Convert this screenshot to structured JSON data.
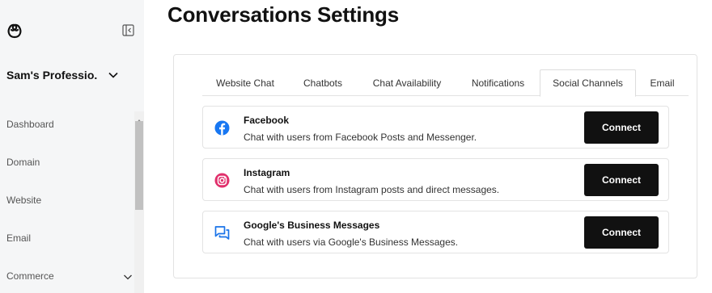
{
  "sidebar": {
    "account_name": "Sam's Professio...",
    "nav": [
      {
        "label": "Dashboard"
      },
      {
        "label": "Domain"
      },
      {
        "label": "Website"
      },
      {
        "label": "Email"
      },
      {
        "label": "Commerce"
      }
    ]
  },
  "page": {
    "title": "Conversations Settings"
  },
  "tabs": [
    {
      "label": "Website Chat",
      "active": false
    },
    {
      "label": "Chatbots",
      "active": false
    },
    {
      "label": "Chat Availability",
      "active": false
    },
    {
      "label": "Notifications",
      "active": false
    },
    {
      "label": "Social Channels",
      "active": true
    },
    {
      "label": "Email",
      "active": false
    }
  ],
  "channels": [
    {
      "title": "Facebook",
      "description": "Chat with users from Facebook Posts and Messenger.",
      "button": "Connect",
      "icon": "facebook-icon",
      "icon_color": "#1877f2"
    },
    {
      "title": "Instagram",
      "description": "Chat with users from Instagram posts and direct messages.",
      "button": "Connect",
      "icon": "instagram-icon",
      "icon_color": "#e1306c"
    },
    {
      "title": "Google's Business Messages",
      "description": "Chat with users via Google's Business Messages.",
      "button": "Connect",
      "icon": "business-messages-icon",
      "icon_color": "#1a73e8"
    }
  ],
  "colors": {
    "sidebar_bg": "#f5f6f7",
    "button_bg": "#111111",
    "button_text": "#ffffff"
  }
}
